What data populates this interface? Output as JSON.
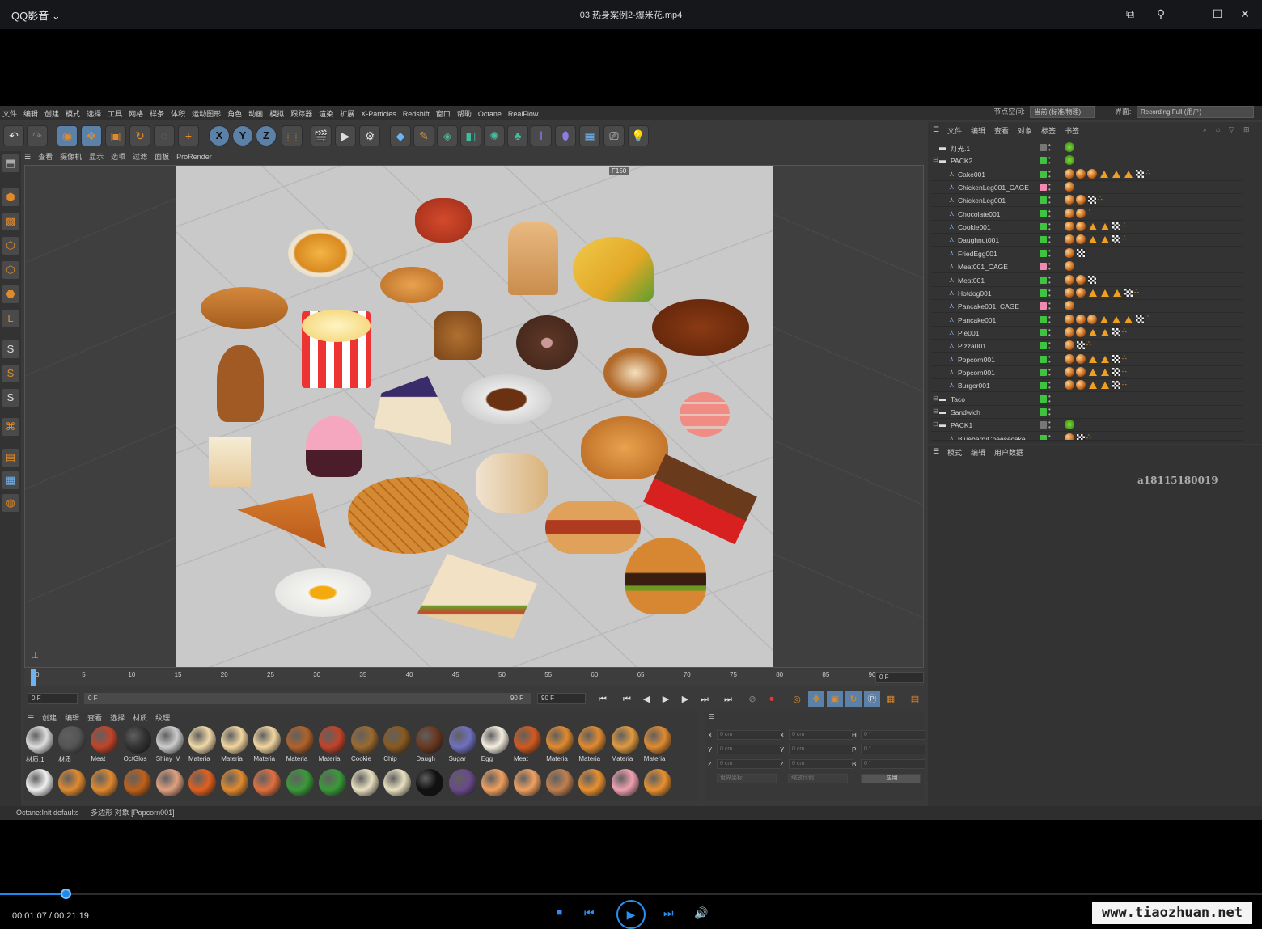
{
  "player": {
    "app_name": "QQ影音",
    "video_title": "03 热身案例2-爆米花.mp4",
    "current_time": "00:01:07",
    "duration": "00:21:19",
    "progress": 0.052,
    "watermark": "www.tiaozhuan.net"
  },
  "c4d": {
    "menus": [
      "文件",
      "编辑",
      "创建",
      "模式",
      "选择",
      "工具",
      "网格",
      "样条",
      "体积",
      "运动图形",
      "角色",
      "动画",
      "模拟",
      "跟踪器",
      "渲染",
      "扩展",
      "X-Particles",
      "Redshift",
      "窗口",
      "帮助",
      "Octane",
      "RealFlow"
    ],
    "node_space_label": "节点空间:",
    "node_space_value": "当前 (标准/物理)",
    "layout_label": "界面:",
    "layout_value": "Recording Full (用户)",
    "viewport_menus": [
      "查看",
      "摄像机",
      "显示",
      "选项",
      "过滤",
      "面板",
      "ProRender"
    ],
    "frame_badge": "F150",
    "timeline_ticks": [
      "0",
      "5",
      "10",
      "15",
      "20",
      "25",
      "30",
      "35",
      "40",
      "45",
      "50",
      "55",
      "60",
      "65",
      "70",
      "75",
      "80",
      "85",
      "90"
    ],
    "timeline_end_field": "0 F",
    "transport": {
      "start": "0 F",
      "range_start": "0 F",
      "range_end": "90 F",
      "end": "90 F"
    },
    "material_menus": [
      "创建",
      "编辑",
      "查看",
      "选择",
      "材质",
      "纹理"
    ],
    "materials_row1": [
      "材质.1",
      "材质",
      "Meat",
      "OctGlos",
      "Shiny_V",
      "Materia",
      "Materia",
      "Materia",
      "Materia",
      "Materia",
      "Cookie",
      "Chip",
      "Daugh",
      "Sugar",
      "Egg",
      "Meat",
      "Materia",
      "Materia",
      "Materia",
      "Materia"
    ],
    "coords": {
      "labels": [
        "X",
        "Y",
        "Z",
        "X",
        "Y",
        "Z",
        "H",
        "P",
        "B"
      ],
      "values": [
        "0 cm",
        "0 cm",
        "0 cm",
        "0 cm",
        "0 cm",
        "0 cm",
        "0 °",
        "0 °",
        "0 °"
      ],
      "world": "世界坐标",
      "scale": "缩放比例",
      "apply": "应用"
    },
    "status_left": "Octane:Init defaults",
    "status_right": "多边形 对象 [Popcorn001]",
    "object_menus": [
      "文件",
      "编辑",
      "查看",
      "对象",
      "标签",
      "书签"
    ],
    "objects": [
      {
        "name": "灯光.1",
        "indent": 0,
        "chk": "#777"
      },
      {
        "name": "PACK2",
        "indent": 0,
        "chk": "#3ec43e"
      },
      {
        "name": "Cake001",
        "indent": 1,
        "chk": "#3ec43e"
      },
      {
        "name": "ChickenLeg001_CAGE",
        "indent": 1,
        "chk": "#f08ab0"
      },
      {
        "name": "ChickenLeg001",
        "indent": 1,
        "chk": "#3ec43e"
      },
      {
        "name": "Chocolate001",
        "indent": 1,
        "chk": "#3ec43e"
      },
      {
        "name": "Cookie001",
        "indent": 1,
        "chk": "#3ec43e"
      },
      {
        "name": "Daughnut001",
        "indent": 1,
        "chk": "#3ec43e"
      },
      {
        "name": "FriedEgg001",
        "indent": 1,
        "chk": "#3ec43e"
      },
      {
        "name": "Meat001_CAGE",
        "indent": 1,
        "chk": "#f08ab0"
      },
      {
        "name": "Meat001",
        "indent": 1,
        "chk": "#3ec43e"
      },
      {
        "name": "Hotdog001",
        "indent": 1,
        "chk": "#3ec43e"
      },
      {
        "name": "Pancake001_CAGE",
        "indent": 1,
        "chk": "#f08ab0"
      },
      {
        "name": "Pancake001",
        "indent": 1,
        "chk": "#3ec43e"
      },
      {
        "name": "Pie001",
        "indent": 1,
        "chk": "#3ec43e"
      },
      {
        "name": "Pizza001",
        "indent": 1,
        "chk": "#3ec43e"
      },
      {
        "name": "Popcorn001",
        "indent": 1,
        "chk": "#3ec43e"
      },
      {
        "name": "Popcorn001",
        "indent": 1,
        "chk": "#3ec43e"
      },
      {
        "name": "Burger001",
        "indent": 1,
        "chk": "#3ec43e"
      },
      {
        "name": "Taco",
        "indent": 0,
        "chk": "#3ec43e"
      },
      {
        "name": "Sandwich",
        "indent": 0,
        "chk": "#3ec43e"
      },
      {
        "name": "PACK1",
        "indent": 0,
        "chk": "#777"
      },
      {
        "name": "BlueberryCheesecake",
        "indent": 1,
        "chk": "#3ec43e"
      }
    ],
    "attr_menus": [
      "模式",
      "编辑",
      "用户数据"
    ],
    "user_watermark": "a18115180019"
  }
}
